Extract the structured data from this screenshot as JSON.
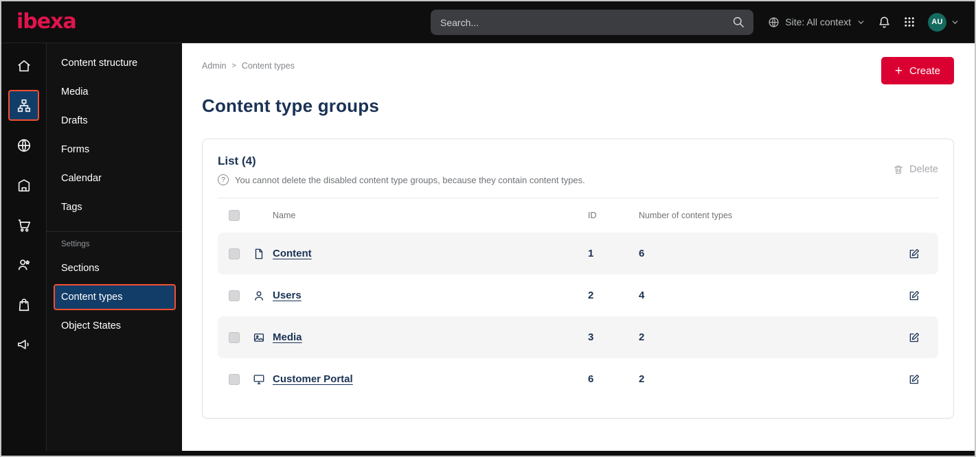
{
  "colors": {
    "accent": "#db0032",
    "active_item_bg": "#123d68",
    "active_item_border": "#f4502e",
    "heading_text": "#1a3254"
  },
  "topbar": {
    "logo_text": "ibexa",
    "search_placeholder": "Search...",
    "site_context_label": "Site: All context",
    "avatar_initials": "AU"
  },
  "sidebar": {
    "items": [
      {
        "label": "Content structure"
      },
      {
        "label": "Media"
      },
      {
        "label": "Drafts"
      },
      {
        "label": "Forms"
      },
      {
        "label": "Calendar"
      },
      {
        "label": "Tags"
      }
    ],
    "settings_heading": "Settings",
    "settings_items": [
      {
        "label": "Sections",
        "active": false
      },
      {
        "label": "Content types",
        "active": true
      },
      {
        "label": "Object States",
        "active": false
      }
    ]
  },
  "breadcrumb": {
    "crumbs": [
      "Admin",
      "Content types"
    ],
    "separator": ">"
  },
  "page": {
    "title": "Content type groups",
    "create_button_label": "Create",
    "create_button_icon": "+"
  },
  "list_card": {
    "title": "List (4)",
    "info_icon_glyph": "?",
    "info_text": "You cannot delete the disabled content type groups, because they contain content types.",
    "delete_button_label": "Delete"
  },
  "table": {
    "headers": {
      "name": "Name",
      "id": "ID",
      "count": "Number of content types"
    },
    "rows": [
      {
        "icon": "file-icon",
        "name": "Content",
        "id": "1",
        "count": "6"
      },
      {
        "icon": "user-icon",
        "name": "Users",
        "id": "2",
        "count": "4"
      },
      {
        "icon": "image-icon",
        "name": "Media",
        "id": "3",
        "count": "2"
      },
      {
        "icon": "monitor-icon",
        "name": "Customer Portal",
        "id": "6",
        "count": "2"
      }
    ]
  }
}
